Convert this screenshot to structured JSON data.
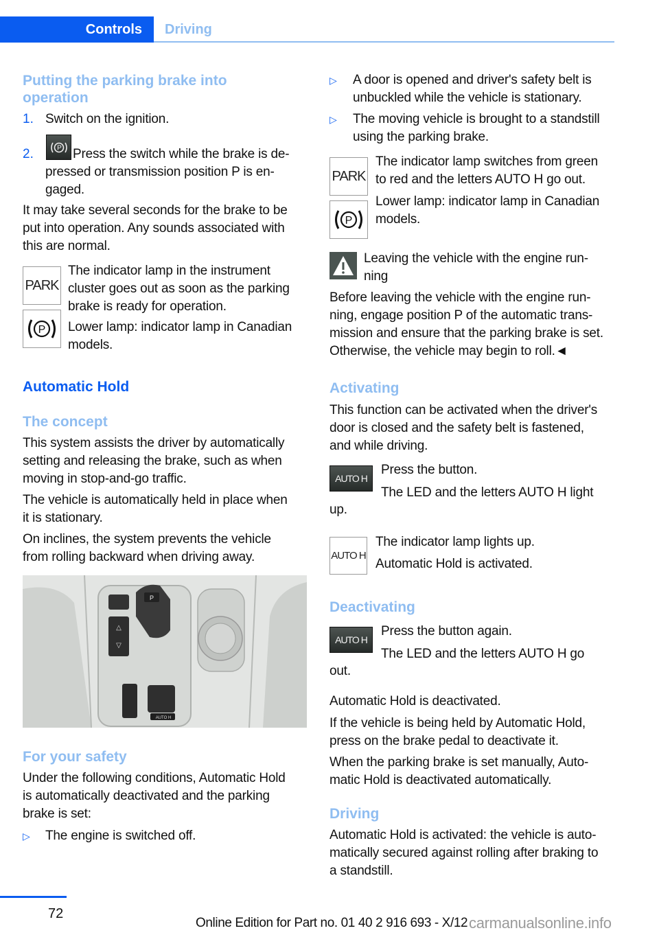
{
  "header": {
    "tabs": [
      {
        "label": "Controls",
        "active": true
      },
      {
        "label": "Driving",
        "active": false
      }
    ]
  },
  "left": {
    "section1": {
      "title_line1": "Putting the parking brake into",
      "title_line2": "operation",
      "steps": [
        {
          "number": "1.",
          "text": "Switch on the ignition."
        },
        {
          "number": "2.",
          "icon": "parking-brake-switch-icon",
          "line1": " Press the switch while the brake is de-",
          "line2": "pressed or transmission position P is en-",
          "line3": "gaged."
        }
      ],
      "para1_lines": [
        "It may take several seconds for the brake to be",
        "put into operation. Any sounds associated with",
        "this are normal."
      ],
      "lamp1": {
        "icon_text": "PARK",
        "lines": [
          "The indicator lamp in the instrument",
          "cluster goes out as soon as the parking",
          "brake is ready for operation."
        ]
      },
      "lamp2": {
        "icon_text": "(P)",
        "lines": [
          "Lower lamp: indicator lamp in Canadian",
          "models."
        ]
      }
    },
    "automatic_hold": {
      "title": "Automatic Hold",
      "concept_title": "The concept",
      "concept_para1": [
        "This system assists the driver by automatically",
        "setting and releasing the brake, such as when",
        "moving in stop-and-go traffic."
      ],
      "concept_para2": [
        "The vehicle is automatically held in place when",
        "it is stationary."
      ],
      "concept_para3": [
        "On inclines, the system prevents the vehicle",
        "from rolling backward when driving away."
      ]
    },
    "photo": {
      "alt": "Center console with gear selector, parking brake switch and AUTO H button",
      "labels": {
        "p": "P",
        "autoh": "AUTO H"
      }
    },
    "safety": {
      "title": "For your safety",
      "para": [
        "Under the following conditions, Automatic Hold",
        "is automatically deactivated and the parking",
        "brake is set:"
      ],
      "bullets": [
        "The engine is switched off."
      ]
    }
  },
  "right": {
    "bullets": [
      [
        "A door is opened and driver's safety belt is",
        "unbuckled while the vehicle is stationary."
      ],
      [
        "The moving vehicle is brought to a standstill",
        "using the parking brake."
      ]
    ],
    "lamp1": {
      "icon_text": "PARK",
      "lines": [
        "The indicator lamp switches from green",
        "to red and the letters AUTO H go out."
      ]
    },
    "lamp2": {
      "icon_text": "(P)",
      "lines": [
        "Lower lamp: indicator lamp in Canadian",
        "models."
      ]
    },
    "warning": {
      "title_lines": [
        "Leaving the vehicle with the engine run-",
        "ning"
      ],
      "body_lines": [
        "Before leaving the vehicle with the engine run-",
        "ning, engage position P of the automatic trans-",
        "mission and ensure that the parking brake is set.",
        "Otherwise, the vehicle may begin to roll.◄"
      ]
    },
    "activating": {
      "title": "Activating",
      "para": [
        "This function can be activated when the driver's",
        "door is closed and the safety belt is fastened,",
        "and while driving."
      ],
      "button_text": "AUTO H",
      "step1": "Press the button.",
      "step2_line1": "The LED and the letters AUTO H light",
      "step2_line2": "up.",
      "lamp_text": "AUTO H",
      "lamp_line1": "The indicator lamp lights up.",
      "lamp_line2": "Automatic Hold is activated."
    },
    "deactivating": {
      "title": "Deactivating",
      "button_text": "AUTO H",
      "step1": "Press the button again.",
      "step2_line1": "The LED and the letters AUTO H go",
      "step2_line2": "out.",
      "para1": "Automatic Hold is deactivated.",
      "para2": [
        "If the vehicle is being held by Automatic Hold,",
        "press on the brake pedal to deactivate it."
      ],
      "para3": [
        "When the parking brake is set manually, Auto-",
        "matic Hold is deactivated automatically."
      ]
    },
    "driving": {
      "title": "Driving",
      "para": [
        "Automatic Hold is activated: the vehicle is auto-",
        "matically secured against rolling after braking to",
        "a standstill."
      ]
    }
  },
  "footer": {
    "page_number": "72",
    "edition": "Online Edition for Part no. 01 40 2 916 693 - X/12",
    "watermark": "carmanualsonline.info"
  },
  "colors": {
    "accent": "#0a5cf0",
    "accent_light": "#8fbdf1"
  }
}
